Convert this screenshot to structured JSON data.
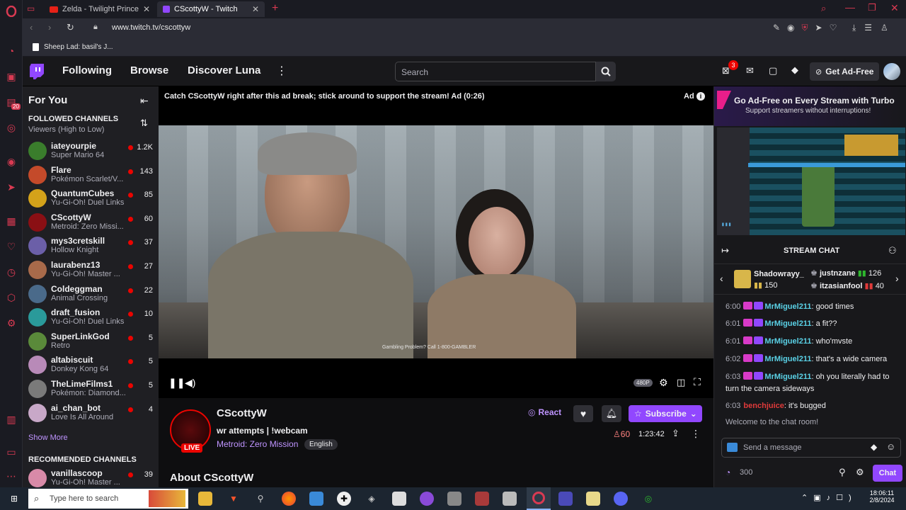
{
  "browser": {
    "tabs": [
      {
        "title": "Zelda - Twilight Princess Ra",
        "active": false
      },
      {
        "title": "CScottyW - Twitch",
        "active": true
      }
    ],
    "url": "www.twitch.tv/cscottyw",
    "bookmark": "Sheep Lad: basil's J...",
    "rail_badge": "20"
  },
  "nav": {
    "following": "Following",
    "browse": "Browse",
    "discover": "Discover Luna",
    "search_placeholder": "Search",
    "notif_count": "3",
    "get_ad_free": "Get Ad-Free"
  },
  "sidebar": {
    "for_you": "For You",
    "followed_title": "FOLLOWED CHANNELS",
    "followed_sort": "Viewers (High to Low)",
    "channels": [
      {
        "name": "iateyourpie",
        "game": "Super Mario 64",
        "viewers": "1.2K",
        "color": "#3a7d2c"
      },
      {
        "name": "Flare",
        "game": "Pokémon Scarlet/V...",
        "viewers": "143",
        "color": "#c44a2a"
      },
      {
        "name": "QuantumCubes",
        "game": "Yu-Gi-Oh! Duel Links",
        "viewers": "85",
        "color": "#d4a21a"
      },
      {
        "name": "CScottyW",
        "game": "Metroid: Zero Missi...",
        "viewers": "60",
        "color": "#8a0f14"
      },
      {
        "name": "mys3cretskill",
        "game": "Hollow Knight",
        "viewers": "37",
        "color": "#6b5fa8"
      },
      {
        "name": "laurabenz13",
        "game": "Yu-Gi-Oh! Master ...",
        "viewers": "27",
        "color": "#a86a4a"
      },
      {
        "name": "Coldeggman",
        "game": "Animal Crossing",
        "viewers": "22",
        "color": "#4a6a8a"
      },
      {
        "name": "draft_fusion",
        "game": "Yu-Gi-Oh! Duel Links",
        "viewers": "10",
        "color": "#2a9a9a"
      },
      {
        "name": "SuperLinkGod",
        "game": "Retro",
        "viewers": "5",
        "color": "#5a8a3a"
      },
      {
        "name": "altabiscuit",
        "game": "Donkey Kong 64",
        "viewers": "5",
        "color": "#b88ab8"
      },
      {
        "name": "TheLimeFilms1",
        "game": "Pokémon: Diamond...",
        "viewers": "5",
        "color": "#7a7a7a"
      },
      {
        "name": "ai_chan_bot",
        "game": "Love Is All Around",
        "viewers": "4",
        "color": "#c8a8c8"
      }
    ],
    "show_more": "Show More",
    "recommended_title": "RECOMMENDED CHANNELS",
    "recommended": [
      {
        "name": "vanillascoop",
        "game": "Yu-Gi-Oh! Master ...",
        "viewers": "39",
        "color": "#d88aa8"
      }
    ]
  },
  "player": {
    "ad_banner": "Catch CScottyW right after this ad break; stick around to support the stream! Ad (0:26)",
    "ad_label": "Ad",
    "gambling": "Gambling Problem? Call 1-800-GAMBLER",
    "quality": "480P"
  },
  "stream": {
    "channel": "CScottyW",
    "live": "LIVE",
    "title": "wr attempts | !webcam",
    "game": "Metroid: Zero Mission",
    "tag": "English",
    "react": "React",
    "subscribe": "Subscribe",
    "viewers": "60",
    "uptime": "1:23:42",
    "about": "About CScottyW"
  },
  "chat": {
    "turbo_title": "Go Ad-Free on Every Stream with Turbo",
    "turbo_sub": "Support streamers without interruptions!",
    "header": "STREAM CHAT",
    "leaders": [
      {
        "name": "Shadowrayy_",
        "count": "150"
      },
      {
        "name": "justnzane",
        "count": "126"
      },
      {
        "name": "itzasianfool",
        "count": "40"
      }
    ],
    "messages": [
      {
        "time": "6:00",
        "user": "MrMiguel211",
        "text": ": good times",
        "color": "#5ad1e6"
      },
      {
        "time": "6:01",
        "user": "MrMiguel211",
        "text": ": a fit??",
        "color": "#5ad1e6"
      },
      {
        "time": "6:01",
        "user": "MrMiguel211",
        "text": ": who'mvste",
        "color": "#5ad1e6"
      },
      {
        "time": "6:02",
        "user": "MrMiguel211",
        "text": ": that's a wide camera",
        "color": "#5ad1e6"
      },
      {
        "time": "6:03",
        "user": "MrMiguel211",
        "text": ": oh you literally had to turn the camera sideways",
        "color": "#5ad1e6"
      },
      {
        "time": "6:03",
        "user": "benchjuice",
        "text": ": it's bugged",
        "color": "#e03a3a"
      }
    ],
    "welcome": "Welcome to the chat room!",
    "input_placeholder": "Send a message",
    "points": "300",
    "chat_button": "Chat"
  },
  "taskbar": {
    "search_placeholder": "Type here to search",
    "time": "18:06:11",
    "date": "2/8/2024"
  },
  "colors": {
    "twitch_purple": "#9147ff",
    "live_red": "#eb0400",
    "opera_red": "#d93a52"
  }
}
